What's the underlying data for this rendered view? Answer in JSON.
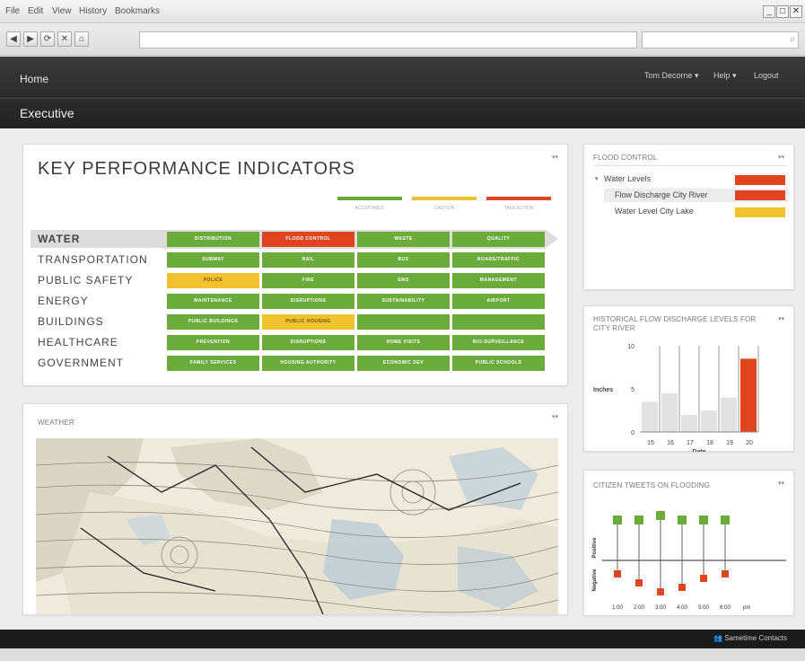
{
  "browser": {
    "menu": [
      "File",
      "Edit",
      "View",
      "History",
      "Bookmarks"
    ],
    "nav": {
      "back": "◀",
      "forward": "▶",
      "reload": "⟳",
      "stop": "✕",
      "home": "⌂"
    },
    "window_controls": {
      "minimize": "_",
      "maximize": "□",
      "close": "✕"
    }
  },
  "header": {
    "home": "Home",
    "title": "Executive",
    "user": "Tom Decorne ▾",
    "help": "Help ▾",
    "logout": "Logout"
  },
  "kpi": {
    "title": "KEY PERFORMANCE INDICATORS",
    "legend": [
      {
        "label": "ACCEPTABLE",
        "color": "#6aab3b"
      },
      {
        "label": "CAUTION",
        "color": "#f2c12e"
      },
      {
        "label": "TAKE ACTION",
        "color": "#e0451f"
      }
    ],
    "rows": [
      {
        "label": "WATER",
        "cells": [
          {
            "label": "DISTRIBUTION",
            "status": "green"
          },
          {
            "label": "FLOOD CONTROL",
            "status": "red"
          },
          {
            "label": "WASTE",
            "status": "green"
          },
          {
            "label": "QUALITY",
            "status": "green"
          }
        ]
      },
      {
        "label": "TRANSPORTATION",
        "cells": [
          {
            "label": "SUBWAY",
            "status": "green"
          },
          {
            "label": "RAIL",
            "status": "green"
          },
          {
            "label": "BUS",
            "status": "green"
          },
          {
            "label": "ROADS/TRAFFIC",
            "status": "green"
          }
        ]
      },
      {
        "label": "PUBLIC SAFETY",
        "cells": [
          {
            "label": "POLICE",
            "status": "yellow"
          },
          {
            "label": "FIRE",
            "status": "green"
          },
          {
            "label": "EMS",
            "status": "green"
          },
          {
            "label": "MANAGEMENT",
            "status": "green"
          }
        ]
      },
      {
        "label": "ENERGY",
        "cells": [
          {
            "label": "MAINTENANCE",
            "status": "green"
          },
          {
            "label": "DISRUPTIONS",
            "status": "green"
          },
          {
            "label": "SUSTAINABILITY",
            "status": "green"
          },
          {
            "label": "AIRPORT",
            "status": "green"
          }
        ]
      },
      {
        "label": "BUILDINGS",
        "cells": [
          {
            "label": "PUBLIC BUILDINGS",
            "status": "green"
          },
          {
            "label": "PUBLIC HOUSING",
            "status": "yellow"
          },
          {
            "label": "",
            "status": "green"
          },
          {
            "label": "",
            "status": "green"
          }
        ]
      },
      {
        "label": "HEALTHCARE",
        "cells": [
          {
            "label": "PREVENTION",
            "status": "green"
          },
          {
            "label": "DISRUPTIONS",
            "status": "green"
          },
          {
            "label": "HOME VISITS",
            "status": "green"
          },
          {
            "label": "BIO-SURVEILLANCE",
            "status": "green"
          }
        ]
      },
      {
        "label": "GOVERNMENT",
        "cells": [
          {
            "label": "FAMILY SERVICES",
            "status": "green"
          },
          {
            "label": "HOUSING AUTHORITY",
            "status": "green"
          },
          {
            "label": "ECONOMIC DEV",
            "status": "green"
          },
          {
            "label": "PUBLIC SCHOOLS",
            "status": "green"
          }
        ]
      }
    ]
  },
  "weather": {
    "title": "WEATHER"
  },
  "flood": {
    "title": "FLOOD CONTROL",
    "items": [
      {
        "label": "Water Levels",
        "status": "red"
      },
      {
        "label": "Flow Discharge City River",
        "status": "red"
      },
      {
        "label": "Water Level City Lake",
        "status": "yellow"
      }
    ]
  },
  "panel_menu": "▾▾",
  "colors": {
    "green": "#6aab3b",
    "yellow": "#f2c12e",
    "red": "#e0451f"
  },
  "chart_data": [
    {
      "type": "bar",
      "title": "HISTORICAL FLOW DISCHARGE LEVELS FOR CITY RIVER",
      "xlabel": "Date",
      "ylabel": "Inches",
      "categories": [
        "15",
        "16",
        "17",
        "18",
        "19",
        "20"
      ],
      "values": [
        3.5,
        4.5,
        2,
        2.5,
        4,
        8.5
      ],
      "ylim": [
        0,
        10
      ],
      "yticks": [
        0,
        5,
        10
      ],
      "highlight": "20"
    },
    {
      "type": "scatter",
      "title": "CITIZEN TWEETS ON FLOODING",
      "categories": [
        "1:00",
        "2:00",
        "3:00",
        "4:00",
        "5:00",
        "6:00"
      ],
      "unit": "pm",
      "positive": [
        4.5,
        4.5,
        5,
        4.5,
        4.5,
        4.5
      ],
      "negative": [
        -1.5,
        -2.5,
        -3.5,
        -3,
        -2,
        -1.5
      ],
      "ylim": [
        -4,
        6
      ],
      "labels": {
        "positive": "Positive",
        "negative": "Negative"
      }
    }
  ],
  "footer": {
    "sametime": "Sametime Contacts"
  }
}
